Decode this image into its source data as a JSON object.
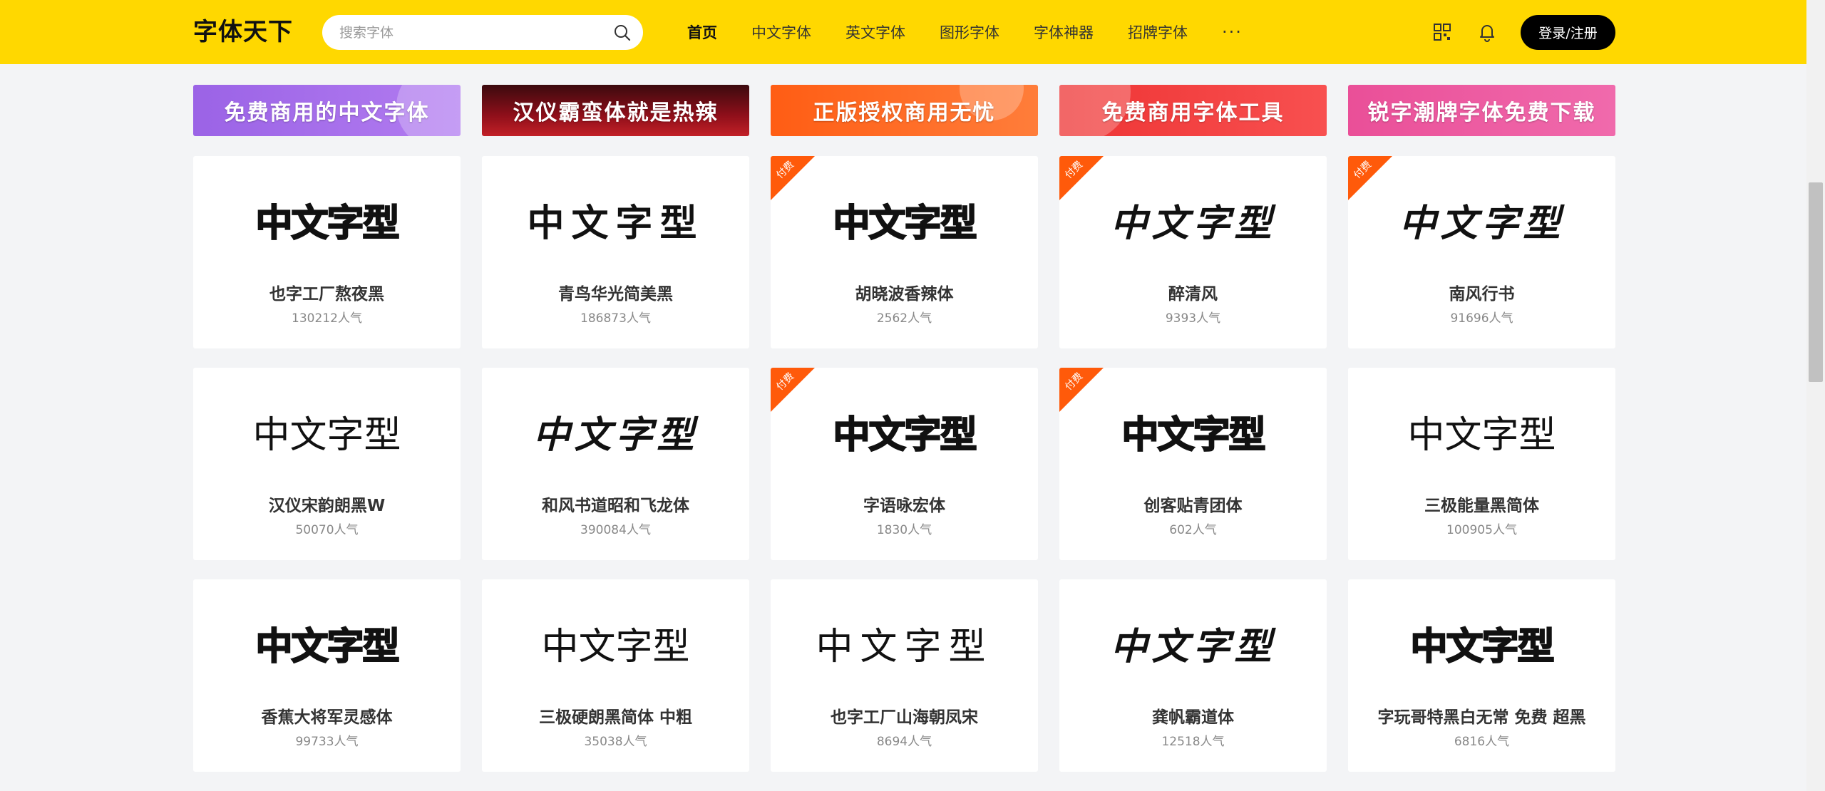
{
  "header": {
    "logo": "字体天下",
    "search_placeholder": "搜索字体",
    "nav": [
      "首页",
      "中文字体",
      "英文字体",
      "图形字体",
      "字体神器",
      "招牌字体"
    ],
    "nav_more": "···",
    "login_label": "登录/注册"
  },
  "banners": [
    {
      "text": "免费商用的中文字体",
      "color": "#a06be6"
    },
    {
      "text": "汉仪霸蛮体就是热辣",
      "color": "#8f0f1a"
    },
    {
      "text": "正版授权商用无忧",
      "color": "#ff6a1f"
    },
    {
      "text": "免费商用字体工具",
      "color": "#f23b3b"
    },
    {
      "text": "锐字潮牌字体免费下载",
      "color": "#ef5aa0"
    }
  ],
  "paid_label": "付费",
  "cards": [
    {
      "preview": "中文字型",
      "name": "也字工厂熬夜黑",
      "popularity": "130212人气",
      "paid": false
    },
    {
      "preview": "中文字型",
      "name": "青鸟华光简美黑",
      "popularity": "186873人气",
      "paid": false
    },
    {
      "preview": "中文字型",
      "name": "胡晓波香辣体",
      "popularity": "2562人气",
      "paid": true
    },
    {
      "preview": "中文字型",
      "name": "醉清风",
      "popularity": "9393人气",
      "paid": true
    },
    {
      "preview": "中文字型",
      "name": "南风行书",
      "popularity": "91696人气",
      "paid": true
    },
    {
      "preview": "中文字型",
      "name": "汉仪宋韵朗黑W",
      "popularity": "50070人气",
      "paid": false
    },
    {
      "preview": "中文字型",
      "name": "和风书道昭和飞龙体",
      "popularity": "390084人气",
      "paid": false
    },
    {
      "preview": "中文字型",
      "name": "字语咏宏体",
      "popularity": "1830人气",
      "paid": true
    },
    {
      "preview": "中文字型",
      "name": "创客贴青团体",
      "popularity": "602人气",
      "paid": true
    },
    {
      "preview": "中文字型",
      "name": "三极能量黑简体",
      "popularity": "100905人气",
      "paid": false
    },
    {
      "preview": "中文字型",
      "name": "香蕉大将军灵感体",
      "popularity": "99733人气",
      "paid": false
    },
    {
      "preview": "中文字型",
      "name": "三极硬朗黑简体 中粗",
      "popularity": "35038人气",
      "paid": false
    },
    {
      "preview": "中文字型",
      "name": "也字工厂山海朝凤宋",
      "popularity": "8694人气",
      "paid": false
    },
    {
      "preview": "中文字型",
      "name": "龚帆霸道体",
      "popularity": "12518人气",
      "paid": false
    },
    {
      "preview": "中文字型",
      "name": "字玩哥特黑白无常 免费 超黑",
      "popularity": "6816人气",
      "paid": false
    }
  ]
}
